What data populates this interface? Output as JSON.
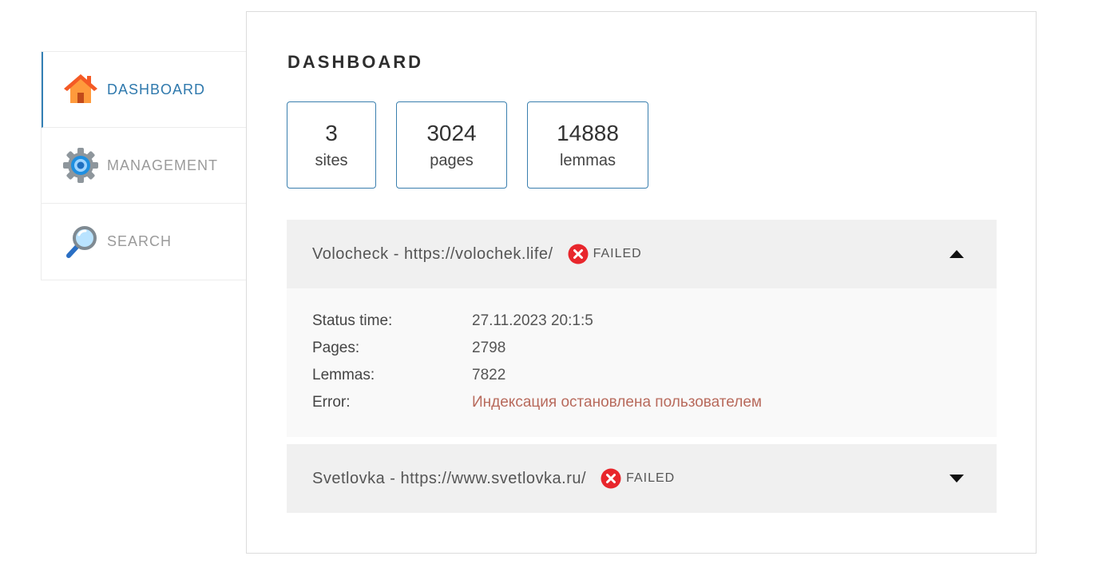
{
  "nav": {
    "items": [
      {
        "label": "DASHBOARD",
        "icon": "home-icon",
        "active": true
      },
      {
        "label": "MANAGEMENT",
        "icon": "gear-icon",
        "active": false
      },
      {
        "label": "SEARCH",
        "icon": "magnifier-icon",
        "active": false
      }
    ]
  },
  "dashboard": {
    "title": "DASHBOARD",
    "stats": [
      {
        "value": "3",
        "label": "sites"
      },
      {
        "value": "3024",
        "label": "pages"
      },
      {
        "value": "14888",
        "label": "lemmas"
      }
    ],
    "sites": [
      {
        "name": "Volocheck - https://volochek.life/",
        "status": "FAILED",
        "expanded": true,
        "details": {
          "status_time_label": "Status time:",
          "status_time": "27.11.2023 20:1:5",
          "pages_label": "Pages:",
          "pages": "2798",
          "lemmas_label": "Lemmas:",
          "lemmas": "7822",
          "error_label": "Error:",
          "error": "Индексация остановлена пользователем"
        }
      },
      {
        "name": "Svetlovka - https://www.svetlovka.ru/",
        "status": "FAILED",
        "expanded": false
      }
    ]
  },
  "colors": {
    "accent": "#2f79ad",
    "failed": "#e8262c",
    "error_text": "#b86a5c",
    "site_header_bg": "#f0f0f0"
  }
}
